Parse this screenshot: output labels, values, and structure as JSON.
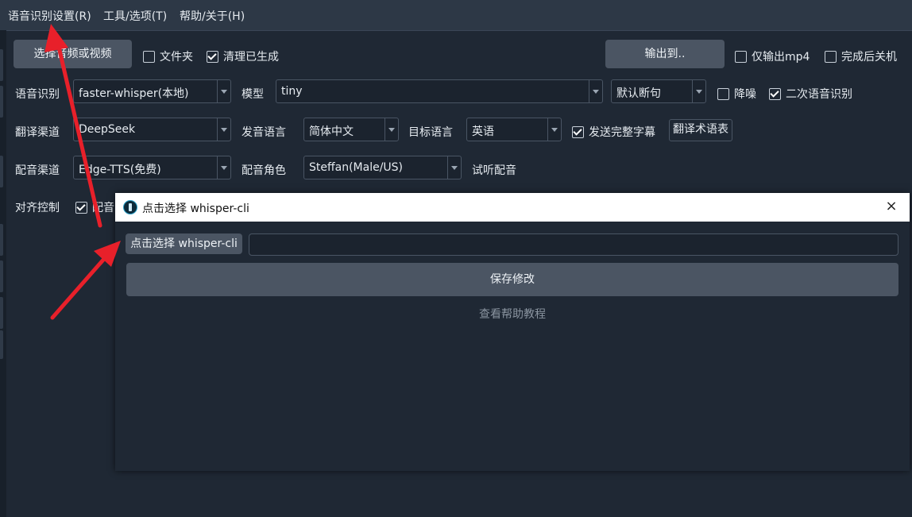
{
  "menu": {
    "items": [
      "语音识别设置(R)",
      "工具/选项(T)",
      "帮助/关于(H)"
    ]
  },
  "row1": {
    "select_media": "选择音频或视频",
    "folder": "文件夹",
    "clean": "清理已生成",
    "output_to": "输出到..",
    "only_mp4": "仅输出mp4",
    "shutdown": "完成后关机"
  },
  "row2": {
    "asr_label": "语音识别",
    "asr_value": "faster-whisper(本地)",
    "model_label": "模型",
    "model_value": "tiny",
    "split_value": "默认断句",
    "denoise": "降噪",
    "second_asr": "二次语音识别"
  },
  "row3": {
    "translate_label": "翻译渠道",
    "translate_value": "DeepSeek",
    "source_label": "发音语言",
    "source_value": "简体中文",
    "target_label": "目标语言",
    "target_value": "英语",
    "send_full": "发送完整字幕",
    "glossary": "翻译术语表"
  },
  "row4": {
    "dub_label": "配音渠道",
    "dub_value": "Edge-TTS(免费)",
    "role_label": "配音角色",
    "role_value": "Steffan(Male/US)",
    "preview": "试听配音"
  },
  "row5": {
    "align_label": "对齐控制",
    "dub_partial": "配音"
  },
  "dialog": {
    "title": "点击选择 whisper-cli",
    "close": "×",
    "pick_button": "点击选择 whisper-cli",
    "path_value": "",
    "save": "保存修改",
    "help": "查看帮助教程"
  },
  "colors": {
    "background": "#1f2834",
    "menubar": "#2d3846",
    "button": "#4b5563",
    "arrow": "#e8202a"
  }
}
